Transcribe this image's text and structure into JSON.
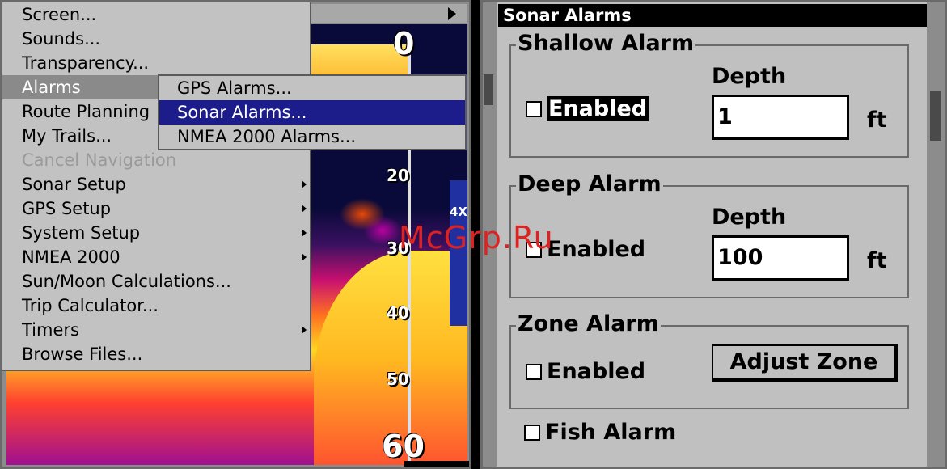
{
  "left_menu": {
    "items": [
      {
        "label": "Screen...",
        "state": "normal",
        "has_submenu": false
      },
      {
        "label": "Sounds...",
        "state": "normal",
        "has_submenu": false
      },
      {
        "label": "Transparency...",
        "state": "normal",
        "has_submenu": false
      },
      {
        "label": "Alarms",
        "state": "selected",
        "has_submenu": true
      },
      {
        "label": "Route Planning",
        "state": "normal",
        "has_submenu": false
      },
      {
        "label": "My Trails...",
        "state": "normal",
        "has_submenu": false
      },
      {
        "label": "Cancel Navigation",
        "state": "disabled",
        "has_submenu": false
      },
      {
        "label": "Sonar Setup",
        "state": "normal",
        "has_submenu": true
      },
      {
        "label": "GPS Setup",
        "state": "normal",
        "has_submenu": true
      },
      {
        "label": "System Setup",
        "state": "normal",
        "has_submenu": true
      },
      {
        "label": "NMEA 2000",
        "state": "normal",
        "has_submenu": true
      },
      {
        "label": "Sun/Moon Calculations...",
        "state": "normal",
        "has_submenu": false
      },
      {
        "label": "Trip Calculator...",
        "state": "normal",
        "has_submenu": false
      },
      {
        "label": "Timers",
        "state": "normal",
        "has_submenu": true
      },
      {
        "label": "Browse Files...",
        "state": "normal",
        "has_submenu": false
      }
    ],
    "submenu": [
      {
        "label": "GPS Alarms...",
        "state": "normal"
      },
      {
        "label": "Sonar Alarms...",
        "state": "selected"
      },
      {
        "label": "NMEA 2000 Alarms...",
        "state": "normal"
      }
    ]
  },
  "sonar": {
    "depth_ticks": [
      "0",
      "20",
      "30",
      "40",
      "50",
      "60"
    ],
    "zoom_label": "4X"
  },
  "dialog": {
    "title": "Sonar Alarms",
    "shallow": {
      "title": "Shallow Alarm",
      "enabled_label": "Enabled",
      "enabled": false,
      "depth_label": "Depth",
      "depth_value": "1",
      "unit": "ft"
    },
    "deep": {
      "title": "Deep Alarm",
      "enabled_label": "Enabled",
      "enabled": false,
      "depth_label": "Depth",
      "depth_value": "100",
      "unit": "ft"
    },
    "zone": {
      "title": "Zone Alarm",
      "enabled_label": "Enabled",
      "enabled": false,
      "adjust_button": "Adjust Zone"
    },
    "fish": {
      "label": "Fish Alarm",
      "enabled": false
    }
  },
  "watermark": "McGrp.Ru",
  "colors": {
    "menu_bg": "#c2c2c2",
    "menu_selected_gray": "#8a8a8a",
    "submenu_selected": "#1c1c8a",
    "dialog_bg": "#c0c0c0",
    "watermark": "#dd2222"
  }
}
